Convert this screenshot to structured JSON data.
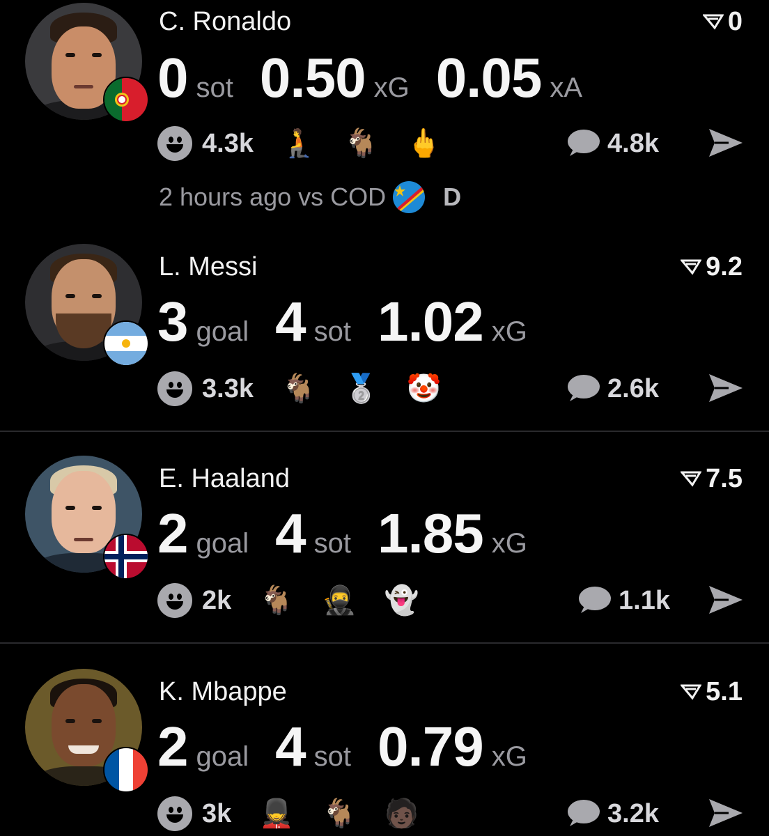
{
  "players": [
    {
      "name": "C. Ronaldo",
      "rating": "0",
      "stats": [
        {
          "value": "0",
          "unit": "sot"
        },
        {
          "value": "0.50",
          "unit": "xG"
        },
        {
          "value": "0.05",
          "unit": "xA"
        }
      ],
      "reactions_count": "4.3k",
      "reaction_emojis": [
        "🧎",
        "🐐",
        "🖕"
      ],
      "comments_count": "4.8k",
      "match_time": "2 hours ago vs COD",
      "match_result": "D",
      "flag": "portugal-flag-icon"
    },
    {
      "name": "L. Messi",
      "rating": "9.2",
      "stats": [
        {
          "value": "3",
          "unit": "goal"
        },
        {
          "value": "4",
          "unit": "sot"
        },
        {
          "value": "1.02",
          "unit": "xG"
        }
      ],
      "reactions_count": "3.3k",
      "reaction_emojis": [
        "🐐",
        "🥈",
        "🤡"
      ],
      "comments_count": "2.6k",
      "flag": "argentina-flag-icon"
    },
    {
      "name": "E. Haaland",
      "rating": "7.5",
      "stats": [
        {
          "value": "2",
          "unit": "goal"
        },
        {
          "value": "4",
          "unit": "sot"
        },
        {
          "value": "1.85",
          "unit": "xG"
        }
      ],
      "reactions_count": "2k",
      "reaction_emojis": [
        "🐐",
        "🥷",
        "👻"
      ],
      "comments_count": "1.1k",
      "flag": "norway-flag-icon"
    },
    {
      "name": "K. Mbappe",
      "rating": "5.1",
      "stats": [
        {
          "value": "2",
          "unit": "goal"
        },
        {
          "value": "4",
          "unit": "sot"
        },
        {
          "value": "0.79",
          "unit": "xG"
        }
      ],
      "reactions_count": "3k",
      "reaction_emojis": [
        "💂",
        "🐐",
        "🧑🏿"
      ],
      "comments_count": "3.2k",
      "flag": "france-flag-icon"
    }
  ],
  "colors": {
    "background": "#000000",
    "text_primary": "#f5f5f5",
    "text_secondary": "#9a9aa0",
    "divider": "#2a2a2d"
  }
}
